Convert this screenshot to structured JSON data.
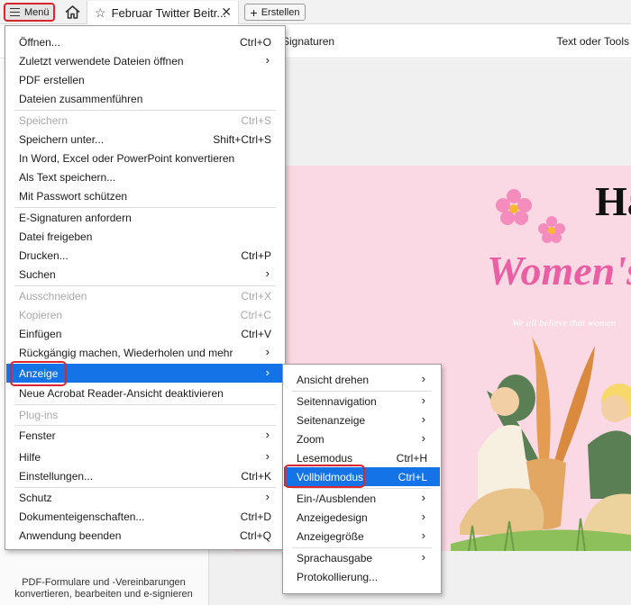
{
  "topbar": {
    "menu_label": "Menü",
    "doc_tab_title": "Februar Twitter Beitr...",
    "create_label": "Erstellen"
  },
  "toolbar": {
    "signatures_label": "Signaturen",
    "text_tools_label": "Text oder Tools"
  },
  "left_panel": {
    "hint_line1": "PDF-Formulare und -Vereinbarungen",
    "hint_line2": "konvertieren, bearbeiten und e-signieren"
  },
  "main_menu": [
    {
      "label": "Öffnen...",
      "shortcut": "Ctrl+O"
    },
    {
      "label": "Zuletzt verwendete Dateien öffnen",
      "arrow": true
    },
    {
      "label": "PDF erstellen"
    },
    {
      "label": "Dateien zusammenführen"
    },
    {
      "label": "Speichern",
      "shortcut": "Ctrl+S",
      "disabled": true
    },
    {
      "label": "Speichern unter...",
      "shortcut": "Shift+Ctrl+S"
    },
    {
      "label": "In Word, Excel oder PowerPoint konvertieren"
    },
    {
      "label": "Als Text speichern..."
    },
    {
      "label": "Mit Passwort schützen"
    },
    {
      "label": "E-Signaturen anfordern"
    },
    {
      "label": "Datei freigeben"
    },
    {
      "label": "Drucken...",
      "shortcut": "Ctrl+P"
    },
    {
      "label": "Suchen",
      "arrow": true
    },
    {
      "label": "Ausschneiden",
      "shortcut": "Ctrl+X",
      "disabled": true
    },
    {
      "label": "Kopieren",
      "shortcut": "Ctrl+C",
      "disabled": true
    },
    {
      "label": "Einfügen",
      "shortcut": "Ctrl+V"
    },
    {
      "label": "Rückgängig machen, Wiederholen und mehr",
      "arrow": true
    },
    {
      "label": "Anzeige",
      "arrow": true,
      "highlighted": true
    },
    {
      "label": "Neue Acrobat Reader-Ansicht deaktivieren"
    },
    {
      "label": "Plug-ins",
      "disabled": true
    },
    {
      "label": "Fenster",
      "arrow": true
    },
    {
      "label": "Hilfe",
      "arrow": true
    },
    {
      "label": "Einstellungen...",
      "shortcut": "Ctrl+K"
    },
    {
      "label": "Schutz",
      "arrow": true
    },
    {
      "label": "Dokumenteigenschaften...",
      "shortcut": "Ctrl+D"
    },
    {
      "label": "Anwendung beenden",
      "shortcut": "Ctrl+Q"
    }
  ],
  "sub_menu": [
    {
      "label": "Ansicht drehen",
      "arrow": true
    },
    {
      "label": "Seitennavigation",
      "arrow": true
    },
    {
      "label": "Seitenanzeige",
      "arrow": true
    },
    {
      "label": "Zoom",
      "arrow": true
    },
    {
      "label": "Lesemodus",
      "shortcut": "Ctrl+H"
    },
    {
      "label": "Vollbildmodus",
      "shortcut": "Ctrl+L",
      "highlighted": true
    },
    {
      "label": "Ein-/Ausblenden",
      "arrow": true
    },
    {
      "label": "Anzeigedesign",
      "arrow": true
    },
    {
      "label": "Anzeigegröße",
      "arrow": true
    },
    {
      "label": "Sprachausgabe",
      "arrow": true
    },
    {
      "label": "Protokollierung..."
    }
  ],
  "document": {
    "heading_fragment": "Ha",
    "womens_text": "Women's",
    "tagline": "We all believe that women"
  },
  "colors": {
    "highlight": "#1473e6",
    "annotation_red": "#d9262c",
    "page_bg": "#fbd9e4",
    "title_pink": "#e85fa3"
  },
  "icons": {
    "menu": "hamburger-icon",
    "home": "home-icon",
    "favorite": "star-icon",
    "close": "close-icon",
    "create": "plus-icon",
    "submenu": "chevron-right-icon"
  }
}
